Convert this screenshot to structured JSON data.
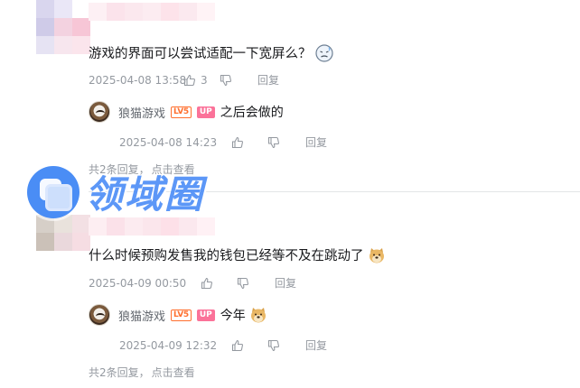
{
  "comments": [
    {
      "text": "游戏的界面可以尝试适配一下宽屏么？",
      "emoji": "sweat-face-emoji",
      "time": "2025-04-08 13:58",
      "likes": "3",
      "reply_label": "回复",
      "reply": {
        "username": "狼猫游戏",
        "level_badge": "LV5",
        "up_badge": "UP",
        "text": "之后会做的",
        "time": "2025-04-08 14:23",
        "reply_label": "回复"
      },
      "more_count": "共2条回复，",
      "more_link": "点击查看"
    },
    {
      "text": "什么时候预购发售我的钱包已经等不及在跳动了",
      "emoji": "doge-emoji",
      "time": "2025-04-09 00:50",
      "likes": "",
      "reply_label": "回复",
      "reply": {
        "username": "狼猫游戏",
        "level_badge": "LV5",
        "up_badge": "UP",
        "text": "今年",
        "emoji": "doge-emoji",
        "time": "2025-04-09 12:32",
        "reply_label": "回复"
      },
      "more_count": "共2条回复，",
      "more_link": "点击查看"
    }
  ],
  "watermark": {
    "text": "领域圈"
  },
  "colors": {
    "accent_pink": "#fb7299",
    "level_orange": "#ff6f2e",
    "watermark_blue": "#4f8ff7",
    "meta_gray": "#9499a0"
  }
}
